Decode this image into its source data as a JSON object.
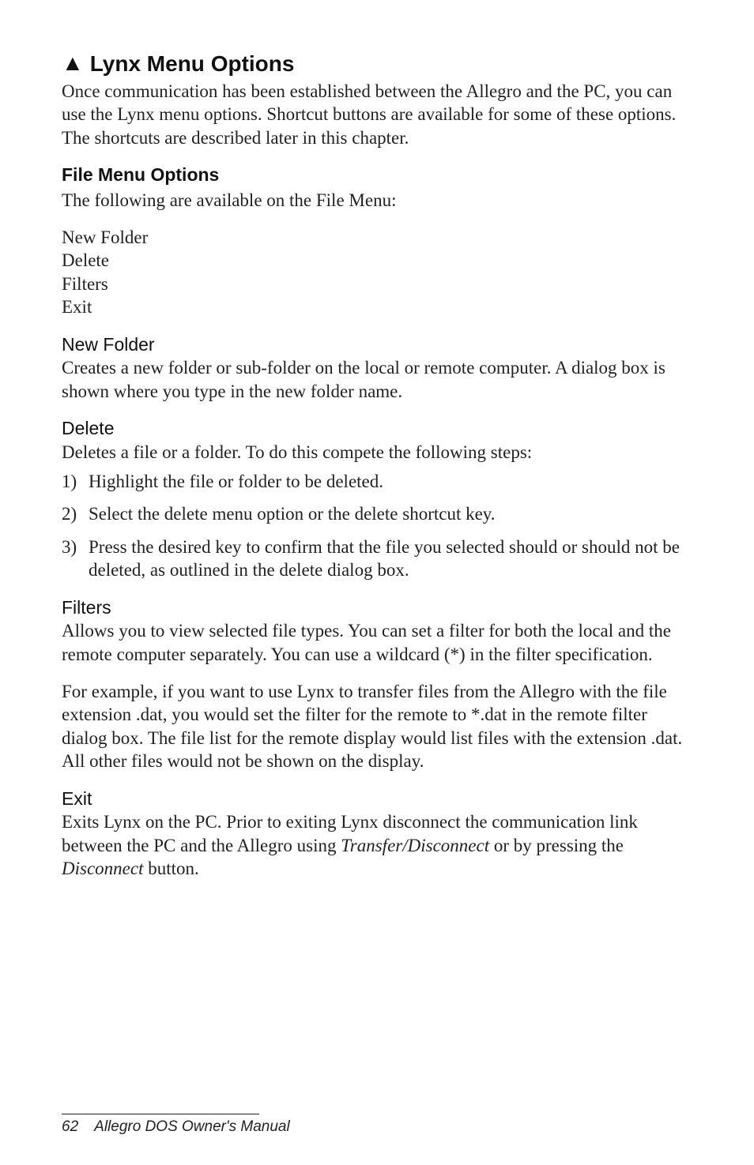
{
  "section": {
    "triangle": "▲",
    "title": "Lynx Menu Options",
    "intro": "Once communication has been established between the Allegro and the PC, you can use the Lynx menu options. Shortcut buttons are available for some of these options. The shortcuts are described later in this chapter."
  },
  "fileMenu": {
    "heading": "File Menu Options",
    "intro": "The following are available on the File Menu:",
    "items": [
      "New Folder",
      "Delete",
      "Filters",
      "Exit"
    ]
  },
  "newFolder": {
    "heading": "New Folder",
    "body": "Creates a new folder or sub-folder on the local or remote computer. A dialog box is shown where you type in the new folder name."
  },
  "delete": {
    "heading": "Delete",
    "intro": "Deletes a file or a folder. To do this compete the following steps:",
    "steps": [
      {
        "num": "1)",
        "text": "Highlight the file or folder to be deleted."
      },
      {
        "num": "2)",
        "text": "Select the delete menu option or the delete shortcut key."
      },
      {
        "num": "3)",
        "text": "Press the desired key to confirm that the file you selected should or should not be deleted, as outlined in the delete dialog box."
      }
    ]
  },
  "filters": {
    "heading": "Filters",
    "p1": "Allows you to view selected file types. You can set a filter for both the local and the remote computer separately. You can use a wildcard (*) in the filter specification.",
    "p2": "For example, if you want to use Lynx to transfer files from the Allegro with the file extension .dat, you would set the filter for the remote to *.dat in the remote filter dialog box. The file list for the remote display would list files with the extension .dat. All other files would not be shown on the display."
  },
  "exit": {
    "heading": "Exit",
    "pre": "Exits Lynx on the PC. Prior to exiting Lynx disconnect the communication link between the PC and the Allegro using ",
    "it1": "Transfer/Disconnect",
    "mid": " or by pressing the ",
    "it2": "Disconnect",
    "post": " button."
  },
  "footer": {
    "page": "62",
    "title": "Allegro DOS Owner's Manual"
  }
}
